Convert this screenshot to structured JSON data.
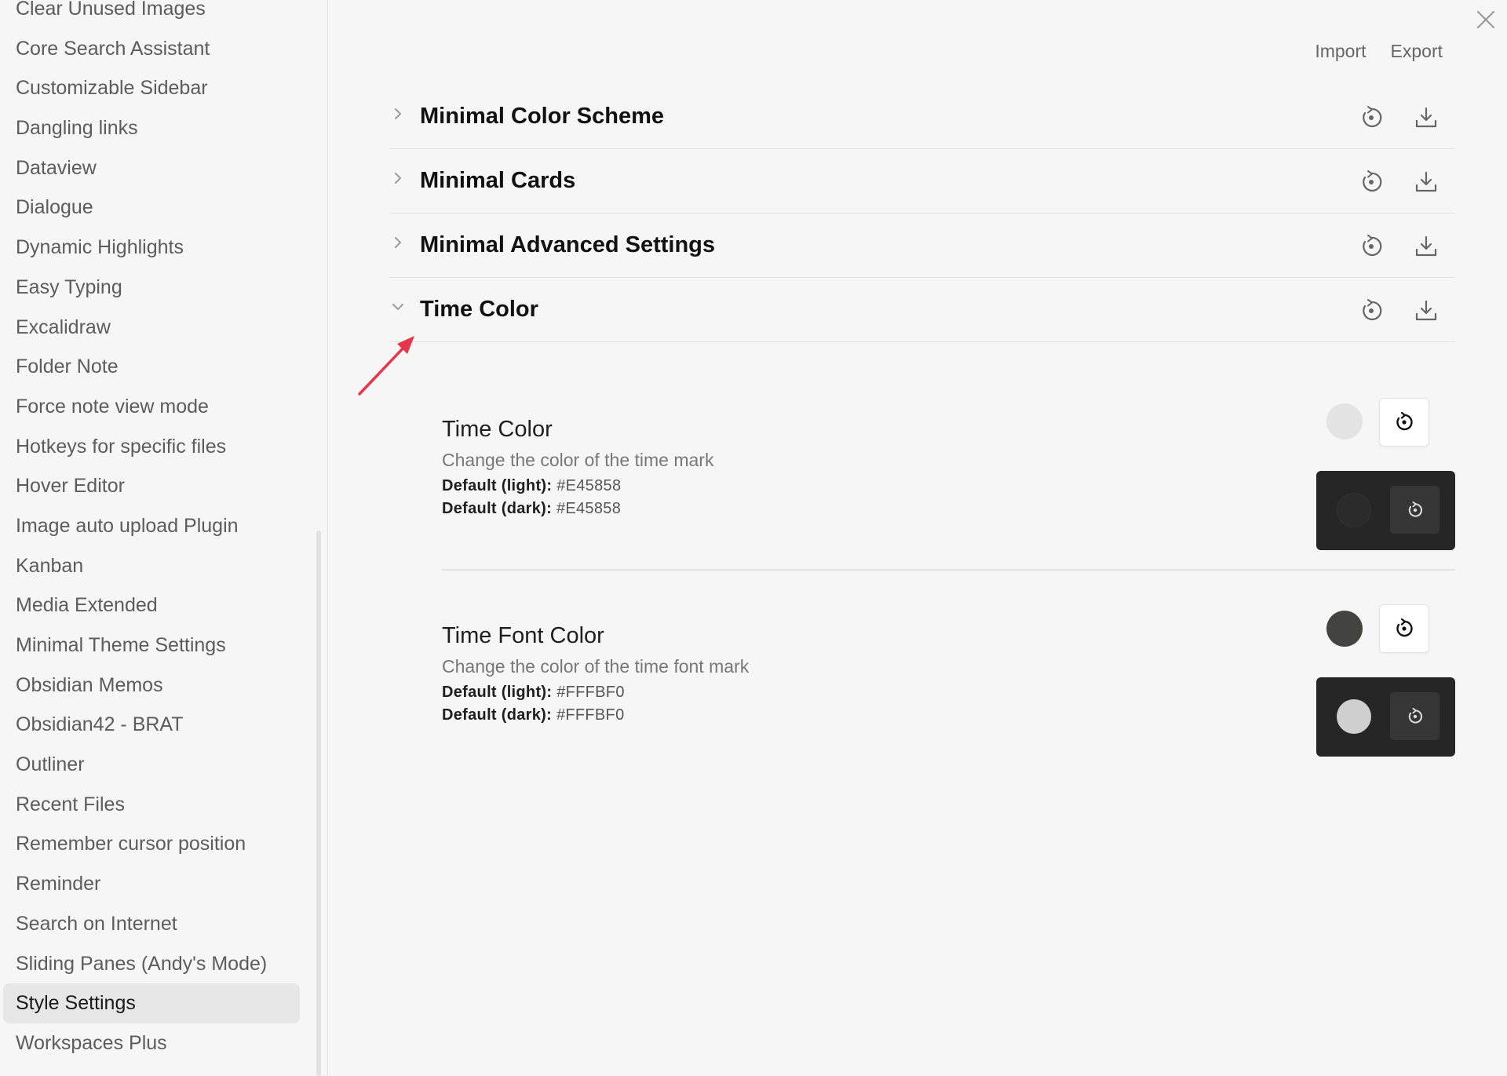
{
  "sidebar": {
    "items": [
      {
        "label": "Clear Unused Images",
        "active": false
      },
      {
        "label": "Core Search Assistant",
        "active": false
      },
      {
        "label": "Customizable Sidebar",
        "active": false
      },
      {
        "label": "Dangling links",
        "active": false
      },
      {
        "label": "Dataview",
        "active": false
      },
      {
        "label": "Dialogue",
        "active": false
      },
      {
        "label": "Dynamic Highlights",
        "active": false
      },
      {
        "label": "Easy Typing",
        "active": false
      },
      {
        "label": "Excalidraw",
        "active": false
      },
      {
        "label": "Folder Note",
        "active": false
      },
      {
        "label": "Force note view mode",
        "active": false
      },
      {
        "label": "Hotkeys for specific files",
        "active": false
      },
      {
        "label": "Hover Editor",
        "active": false
      },
      {
        "label": "Image auto upload Plugin",
        "active": false
      },
      {
        "label": "Kanban",
        "active": false
      },
      {
        "label": "Media Extended",
        "active": false
      },
      {
        "label": "Minimal Theme Settings",
        "active": false
      },
      {
        "label": "Obsidian Memos",
        "active": false
      },
      {
        "label": "Obsidian42 - BRAT",
        "active": false
      },
      {
        "label": "Outliner",
        "active": false
      },
      {
        "label": "Recent Files",
        "active": false
      },
      {
        "label": "Remember cursor position",
        "active": false
      },
      {
        "label": "Reminder",
        "active": false
      },
      {
        "label": "Search on Internet",
        "active": false
      },
      {
        "label": "Sliding Panes (Andy's Mode)",
        "active": false
      },
      {
        "label": "Style Settings",
        "active": true
      },
      {
        "label": "Workspaces Plus",
        "active": false
      }
    ]
  },
  "header": {
    "import_label": "Import",
    "export_label": "Export",
    "close_icon": "close-icon"
  },
  "sections": [
    {
      "title": "Minimal Color Scheme",
      "expanded": false
    },
    {
      "title": "Minimal Cards",
      "expanded": false
    },
    {
      "title": "Minimal Advanced Settings",
      "expanded": false
    },
    {
      "title": "Time Color",
      "expanded": true
    }
  ],
  "settings": [
    {
      "name": "Time Color",
      "description": "Change the color of the time mark",
      "default_light_label": "Default (light):",
      "default_light_value": "#E45858",
      "default_dark_label": "Default (dark):",
      "default_dark_value": "#E45858",
      "light_swatch_color": "#e3e3e3",
      "dark_swatch_color": "#2b2b2b"
    },
    {
      "name": "Time Font Color",
      "description": "Change the color of the time font mark",
      "default_light_label": "Default (light):",
      "default_light_value": "#FFFBF0",
      "default_dark_label": "Default (dark):",
      "default_dark_value": "#FFFBF0",
      "light_swatch_color": "#434341",
      "dark_swatch_color": "#cfcfcf"
    }
  ],
  "colors": {
    "annotation_arrow": "#e8354a",
    "dark_panel": "#262626"
  }
}
